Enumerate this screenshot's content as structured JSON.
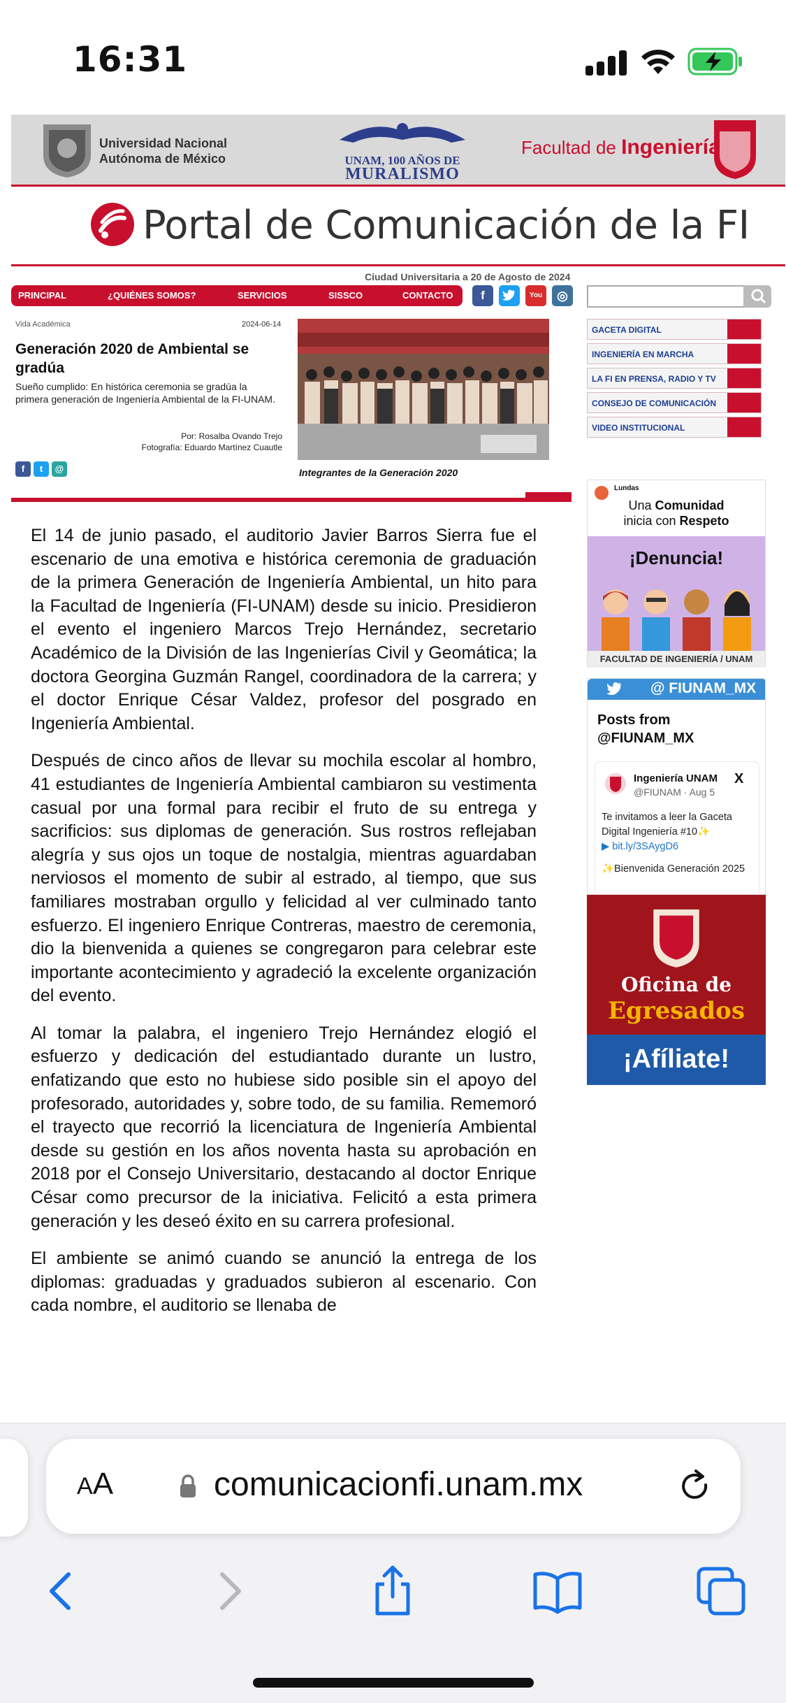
{
  "status": {
    "time": "16:31"
  },
  "header": {
    "unam": "Universidad Nacional Autónoma de México",
    "unam_line1": "Universidad Nacional",
    "unam_line2": "Autónoma de México",
    "muralismo_line1": "UNAM, 100 AÑOS DE",
    "muralismo_line2": "MURALISMO",
    "facultad_prefix": "Facultad de",
    "facultad_name": "Ingeniería",
    "portal_title": "Portal de Comunicación de la FI",
    "date_line": "Ciudad Universitaria a 20 de Agosto de 2024"
  },
  "nav": [
    "PRINCIPAL",
    "¿QUIÉNES SOMOS?",
    "SERVICIOS",
    "SISSCO",
    "CONTACTO"
  ],
  "social": {
    "facebook": "f",
    "twitter": "t",
    "youtube": "You",
    "instagram": "◎"
  },
  "article": {
    "category": "Vida Académica",
    "date": "2024-06-14",
    "title": "Generación 2020 de Ambiental se gradúa",
    "summary": "Sueño cumplido: En histórica ceremonia se gradúa la primera generación de Ingeniería Ambiental de la FI-UNAM.",
    "author": "Por: Rosalba Ovando Trejo",
    "photographer": "Fotografía: Eduardo Martínez Cuautle",
    "caption": "Integrantes de la Generación 2020",
    "paragraphs": [
      "El 14 de junio pasado, el auditorio Javier Barros Sierra fue el escenario de una emotiva e histórica ceremonia de graduación de la primera Generación de Ingeniería Ambiental, un hito para la Facultad de Ingeniería (FI-UNAM) desde su inicio. Presidieron el evento el ingeniero Marcos Trejo Hernández, secretario Académico de la División de las Ingenierías Civil y Geomática; la doctora Georgina Guzmán Rangel, coordinadora de la carrera; y el doctor Enrique César Valdez, profesor del posgrado en Ingeniería Ambiental.",
      "Después de cinco años de llevar su mochila escolar al hombro, 41 estudiantes de Ingeniería Ambiental cambiaron su vestimenta casual por una formal para recibir el fruto de su entrega y sacrificios: sus diplomas de generación. Sus rostros reflejaban alegría y sus ojos un toque de nostalgia, mientras aguardaban nerviosos el momento de subir al estrado, al tiempo, que sus familiares mostraban orgullo y felicidad al ver culminado tanto esfuerzo. El ingeniero Enrique Contreras, maestro de ceremonia, dio la bienvenida a quienes se congregaron para celebrar este importante acontecimiento y agradeció la excelente organización del evento.",
      "Al tomar la palabra, el ingeniero Trejo Hernández elogió el esfuerzo y dedicación del estudiantado durante un lustro, enfatizando que esto no hubiese sido posible sin el apoyo del profesorado, autoridades y, sobre todo, de su familia. Rememoró el trayecto que recorrió la licenciatura de Ingeniería Ambiental desde su gestión en los años noventa hasta su aprobación en 2018 por el Consejo Universitario, destacando al doctor Enrique César como precursor de la iniciativa. Felicitó a esta primera generación y les deseó éxito en su carrera profesional.",
      "El ambiente se animó cuando se anunció la entrega de los diplomas: graduadas y graduados subieron al escenario. Con cada nombre, el auditorio se llenaba de"
    ]
  },
  "sidebar": {
    "links": [
      "GACETA DIGITAL",
      "INGENIERÍA EN MARCHA",
      "LA FI EN PRENSA, RADIO Y TV",
      "CONSEJO DE COMUNICACIÓN",
      "VIDEO INSTITUCIONAL"
    ],
    "denuncia": {
      "brand": "Lundas",
      "line1_a": "Una",
      "line1_b": "Comunidad",
      "line2_a": "inicia con",
      "line2_b": "Respeto",
      "title": "¡Denuncia!",
      "footer": "FACULTAD DE INGENIERÍA / UNAM"
    },
    "twitter": {
      "handle": "@ FIUNAM_MX",
      "posts_title": "Posts from @FIUNAM_MX",
      "posts_line1": "Posts from",
      "posts_line2": "@FIUNAM_MX",
      "name": "Ingeniería UNAM",
      "meta": "@FIUNAM · Aug 5",
      "text": "Te invitamos a leer la Gaceta Digital Ingeniería #10✨",
      "link": "bit.ly/3SAygD6",
      "text2": "✨Bienvenida Generación 2025"
    },
    "egresados": {
      "line1": "Oficina de",
      "line2": "Egresados",
      "line3": "¡Afíliate!"
    }
  },
  "browser": {
    "aa_label": "AA",
    "url": "comunicacionfi.unam.mx"
  },
  "colors": {
    "accent": "#c8102e",
    "link": "#1c3f94",
    "twitter": "#3b8fd6"
  },
  "icons": [
    "back-icon",
    "forward-icon",
    "share-icon",
    "bookmarks-icon",
    "tabs-icon",
    "reload-icon",
    "lock-icon"
  ]
}
